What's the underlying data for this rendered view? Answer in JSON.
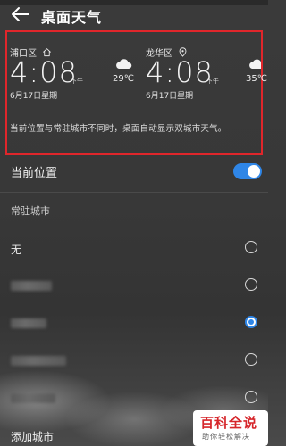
{
  "header": {
    "title": "桌面天气"
  },
  "preview": {
    "left": {
      "city": "浦口区",
      "time": "4:08",
      "ampm": "下午",
      "date": "6月17日星期一",
      "temp": "29℃"
    },
    "right": {
      "city": "龙华区",
      "time": "4:08",
      "ampm": "下午",
      "date": "6月17日星期一",
      "temp": "35℃"
    },
    "notice": "当前位置与常驻城市不同时，桌面自动显示双城市天气。"
  },
  "settings": {
    "current_location_label": "当前位置",
    "current_location_enabled": true,
    "resident_city_label": "常驻城市",
    "options": [
      {
        "label": "无",
        "selected": false
      },
      {
        "label": "",
        "selected": false
      },
      {
        "label": "",
        "selected": false
      },
      {
        "label": "",
        "selected": true
      },
      {
        "label": "",
        "selected": false
      },
      {
        "label": "",
        "selected": false
      }
    ],
    "add_city_label": "添加城市"
  },
  "watermark": {
    "title": "百科全说",
    "subtitle": "助你轻松解决"
  },
  "colors": {
    "accent": "#2f86e7",
    "highlight_border": "#e0262b"
  }
}
